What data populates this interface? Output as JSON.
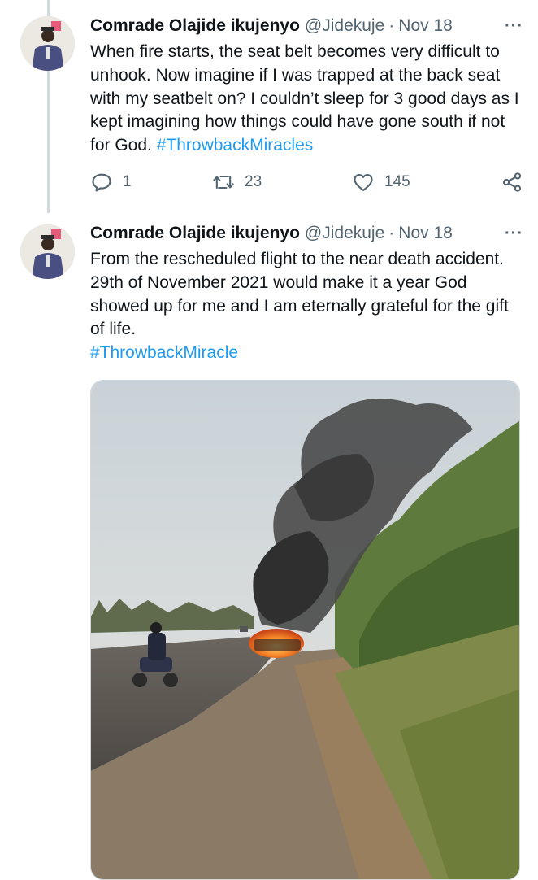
{
  "tweets": [
    {
      "author_name": "Comrade Olajide ikujenyo",
      "handle": "@Jidekuje",
      "separator": "·",
      "date": "Nov 18",
      "more": "···",
      "text_main": "When fire starts, the seat belt becomes very difficult to unhook. Now imagine if I was trapped at the back seat with my seatbelt on? I couldn’t sleep for 3 good days as I kept imagining how things could have gone south if not for God.",
      "hashtag": "#ThrowbackMiracles",
      "replies": "1",
      "retweets": "23",
      "likes": "145"
    },
    {
      "author_name": "Comrade Olajide ikujenyo",
      "handle": "@Jidekuje",
      "separator": "·",
      "date": "Nov 18",
      "more": "···",
      "text_main": "From the rescheduled flight to the near death accident. 29th of November 2021 would make it a year God showed up for me and I am eternally grateful for the gift of life.",
      "hashtag": "#ThrowbackMiracle"
    }
  ],
  "icons": {
    "reply": "reply-icon",
    "retweet": "retweet-icon",
    "like": "heart-icon",
    "share": "share-icon",
    "more": "more-icon"
  },
  "colors": {
    "hashtag": "#1d9bf0",
    "secondary_text": "#536471",
    "primary_text": "#0f1419"
  }
}
